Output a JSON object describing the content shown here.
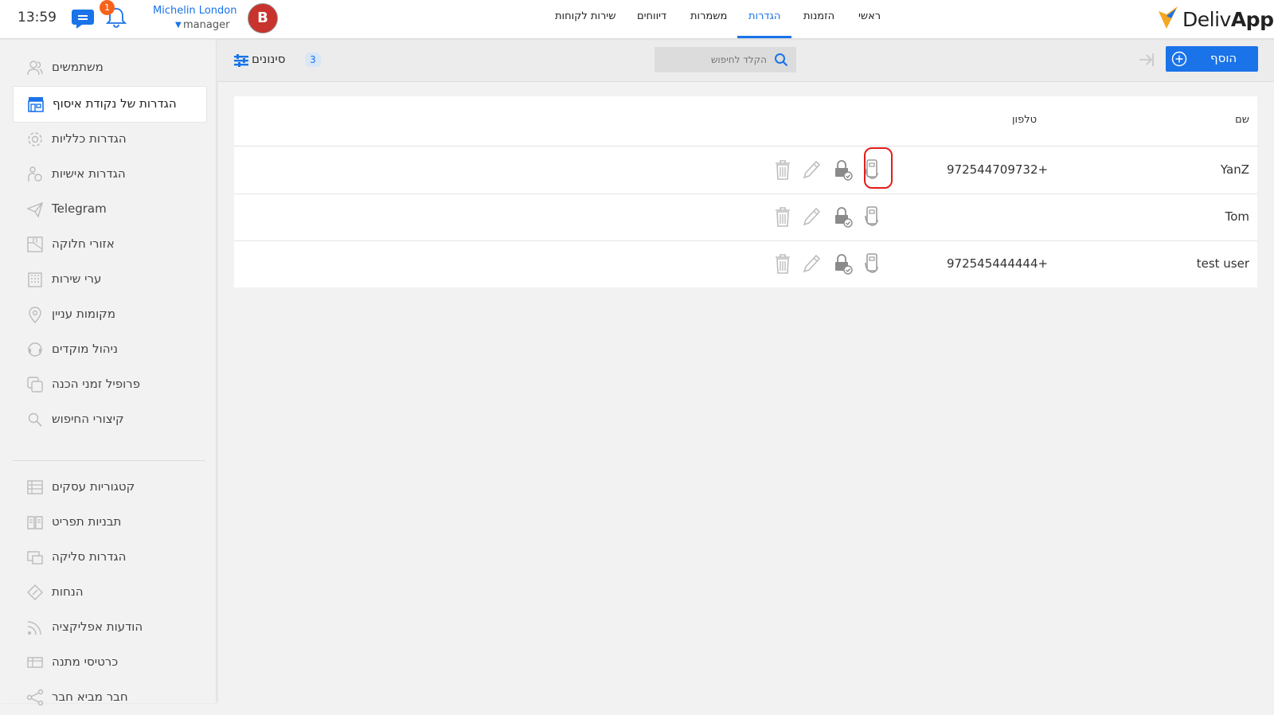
{
  "topbar": {
    "time": "13:59",
    "notifications_count": "1",
    "user": {
      "name": "Michelin London",
      "role": "manager",
      "avatar_letter": "B"
    },
    "nav": [
      {
        "label": "שירות לקוחות"
      },
      {
        "label": "דיווחים"
      },
      {
        "label": "משמרות"
      },
      {
        "label": "הגדרות",
        "active": true
      },
      {
        "label": "הזמנות"
      },
      {
        "label": "ראשי"
      }
    ],
    "logo": {
      "light": "Deliv",
      "bold": "App"
    },
    "accent_color": "#1a73e8"
  },
  "sidebar": {
    "items": [
      {
        "label": "משתמשים",
        "icon": "users-icon"
      },
      {
        "label": "הגדרות של נקודת איסוף",
        "icon": "store-icon",
        "active": true
      },
      {
        "label": "הגדרות כלליות",
        "icon": "gear-icon"
      },
      {
        "label": "הגדרות אישיות",
        "icon": "personal-settings-icon"
      },
      {
        "label": "Telegram",
        "icon": "send-icon"
      },
      {
        "label": "אזורי חלוקה",
        "icon": "map-zones-icon"
      },
      {
        "label": "ערי שירות",
        "icon": "city-icon"
      },
      {
        "label": "מקומות עניין",
        "icon": "map-pin-icon"
      },
      {
        "label": "ניהול מוקדים",
        "icon": "headset-icon"
      },
      {
        "label": "פרופיל זמני הכנה",
        "icon": "copy-icon"
      },
      {
        "label": "קיצורי החיפוש",
        "icon": "search-shortcut-icon"
      },
      {
        "label": "קטגוריות עסקים",
        "icon": "list-icon"
      },
      {
        "label": "תבניות תפריט",
        "icon": "menu-book-icon"
      },
      {
        "label": "הגדרות סליקה",
        "icon": "payment-icon"
      },
      {
        "label": "הנחות",
        "icon": "discount-tag-icon"
      },
      {
        "label": "הודעות אפליקציה",
        "icon": "rss-icon"
      },
      {
        "label": "כרטיסי מתנה",
        "icon": "gift-card-icon"
      },
      {
        "label": "חבר מביא חבר",
        "icon": "share-icon"
      }
    ]
  },
  "toolbar": {
    "filters_label": "סינונים",
    "filters_count": "3",
    "search_placeholder": "הקלד לחיפוש",
    "add_label": "הוסף"
  },
  "table": {
    "headers": {
      "name": "שם",
      "phone": "טלפון"
    },
    "rows": [
      {
        "name": "YanZ",
        "phone": "972544709732+"
      },
      {
        "name": "Tom",
        "phone": ""
      },
      {
        "name": "test user",
        "phone": "972545444444+"
      }
    ],
    "actions": [
      "trash-icon",
      "edit-pencil-icon",
      "lock-check-icon",
      "device-icon"
    ]
  }
}
